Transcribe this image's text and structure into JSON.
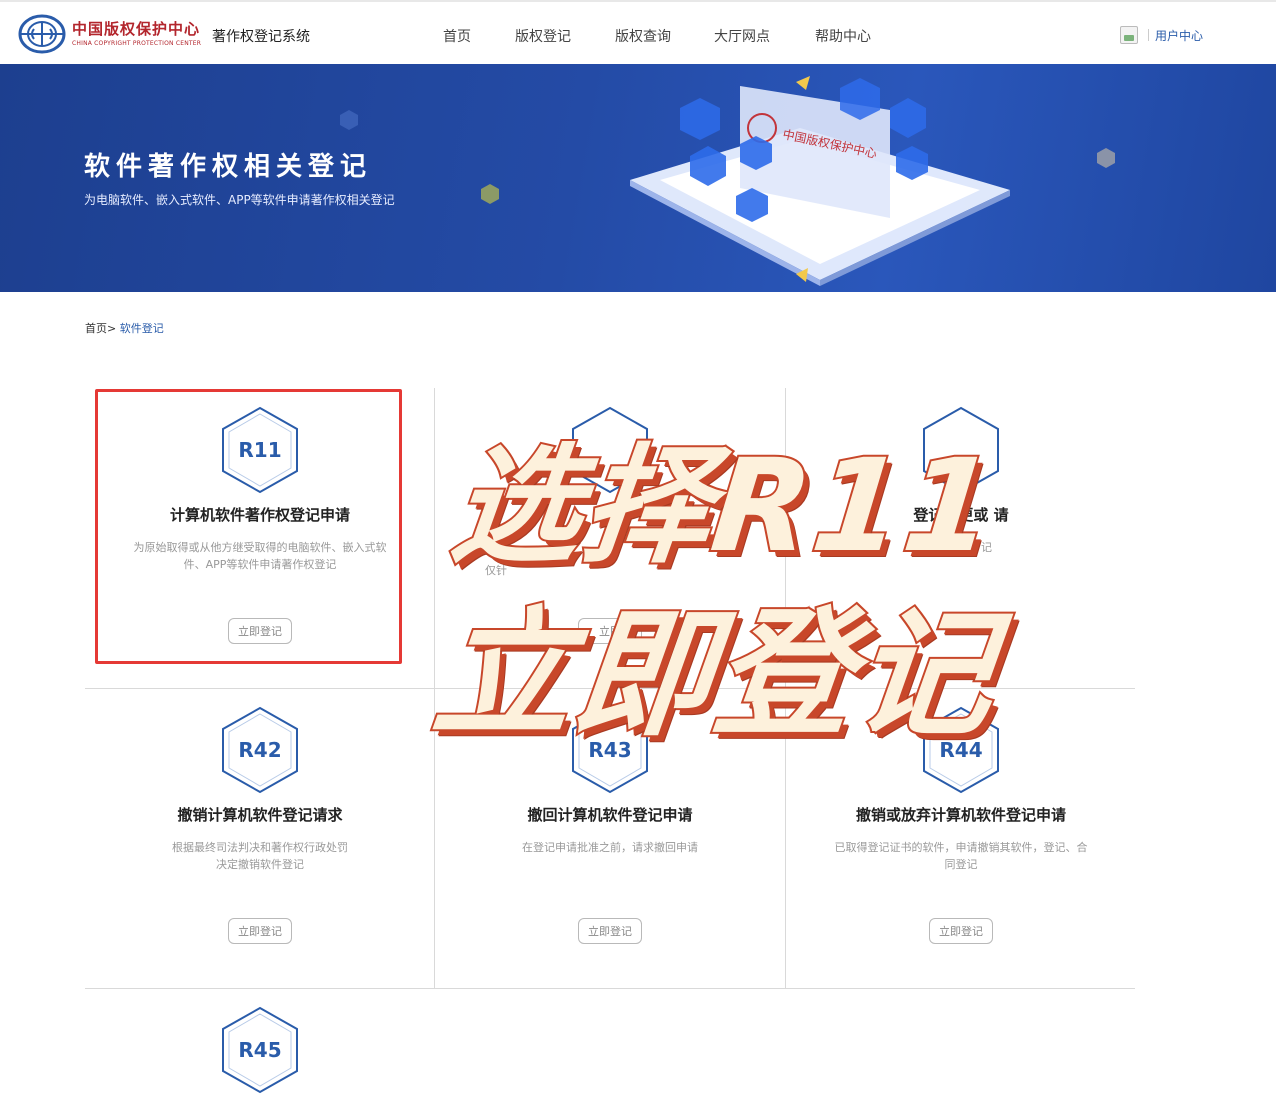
{
  "header": {
    "logo_cn": "中国版权保护中心",
    "logo_en": "CHINA COPYRIGHT PROTECTION CENTER",
    "system_title": "著作权登记系统",
    "nav": [
      "首页",
      "版权登记",
      "版权查询",
      "大厅网点",
      "帮助中心"
    ],
    "user_center": "用户中心"
  },
  "banner": {
    "title": "软件著作权相关登记",
    "subtitle": "为电脑软件、嵌入式软件、APP等软件申请著作权相关登记",
    "illustration_text": "中国版权保护中心"
  },
  "breadcrumb": {
    "home": "首页>",
    "current": "软件登记"
  },
  "cards": [
    {
      "code": "R11",
      "title": "计算机软件著作权登记申请",
      "desc": "为原始取得或从他方继受取得的电脑软件、嵌入式软件、APP等软件申请著作权登记",
      "button": "立即登记"
    },
    {
      "code": "",
      "title": "",
      "desc": "仅针",
      "button": "立即"
    },
    {
      "code": "",
      "title": "登记变更或 请",
      "desc": "登记 变更 记",
      "button": ""
    },
    {
      "code": "R42",
      "title": "撤销计算机软件登记请求",
      "desc": "根据最终司法判决和著作权行政处罚决定撤销软件登记",
      "button": "立即登记"
    },
    {
      "code": "R43",
      "title": "撤回计算机软件登记申请",
      "desc": "在登记申请批准之前，请求撤回申请",
      "button": "立即登记"
    },
    {
      "code": "R44",
      "title": "撤销或放弃计算机软件登记申请",
      "desc": "已取得登记证书的软件，申请撤销其软件，登记、合同登记",
      "button": "立即登记"
    },
    {
      "code": "R45",
      "title": "",
      "desc": "",
      "button": ""
    }
  ],
  "overlay": {
    "line1": "选择R11",
    "line2": "立即登记"
  },
  "colors": {
    "brand_red": "#b3262d",
    "link_blue": "#2a5caa",
    "banner_blue": "#244ba6",
    "highlight_red": "#e53935",
    "overlay_fill": "#fdf1dc",
    "overlay_stroke": "#c8472a"
  }
}
